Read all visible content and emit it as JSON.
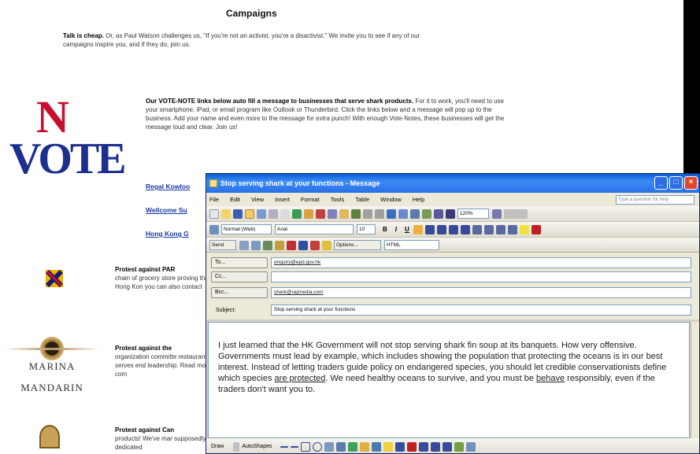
{
  "page": {
    "title": "Campaigns",
    "intro_bold": "Talk is cheap.",
    "intro_rest": " Or, as Paul Watson challenges us, \"If you're not an activist, you're a disactivist.\" We invite you to see if any of our campaigns inspire you, and if they do, join us.",
    "vote_logo_n": "N",
    "vote_logo_vote": "VOTE",
    "votenote_bold": "Our VOTE-NOTE links below auto fill a message to businesses that serve shark products.",
    "votenote_rest": " For it to work, you'll need to use your smartphone, iPad, or email program like Outlook or Thunderbird. Click the links below and a message will pop up to the business. Add your name and even more to the message for extra punch! With enough Vote-Notes, these businesses will get the message loud and clear. Join us!",
    "links": [
      "Regal Kowloo",
      "Wellcome Su",
      "Hong Kong G"
    ],
    "protest1_bold": "Protest against PAR",
    "protest1_rest": "chain of grocery store proving that Hong Kon you can also contact",
    "protest2_bold": "Protest against the",
    "protest2_rest": "organization committe restaurant serves end leadership. Read more com",
    "protest3_bold": "Protest against Can",
    "protest3_rest": "products! We've mar supposedly dedicated",
    "mm_logo_text1": "MARINA",
    "mm_logo_text2": "MANDARIN"
  },
  "email_window": {
    "title": "Stop serving shark at your functions - Message",
    "menu": [
      "File",
      "Edit",
      "View",
      "Insert",
      "Format",
      "Tools",
      "Table",
      "Window",
      "Help"
    ],
    "help_placeholder": "Type a question for help",
    "zoom": "120%",
    "style": "Normal (Web)",
    "font": "Arial",
    "size": "10",
    "send_label": "Send",
    "options_label": "Options...",
    "format_label": "HTML",
    "to_label": "To...",
    "cc_label": "Cc...",
    "bcc_label": "Bcc...",
    "subject_label": "Subject:",
    "to_value": "enquiry@epd.gov.hk",
    "cc_value": "",
    "bcc_value": "shark@sigmedia.com",
    "subject_value": "Stop serving shark at your functions",
    "body_p1": "I just learned that the HK Government will not stop serving shark fin soup at its banquets. How very offensive. Governments must lead by example, which includes showing the population that protecting the oceans is in our best interest. Instead of letting traders guide policy on endangered species, you should let credible conservationists define which species ",
    "body_u1": "are protected",
    "body_p2": ". We need healthy oceans to survive, and you must be ",
    "body_u2": "behave",
    "body_p3": " responsibly, even if the traders don't want you to.",
    "draw_label": "Draw",
    "autoshapes_label": "AutoShapes"
  }
}
